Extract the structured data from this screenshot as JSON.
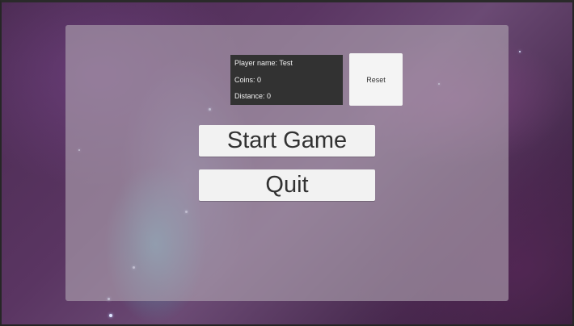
{
  "player_info": {
    "player_name": "Player name: Test",
    "coins": "Coins: 0",
    "distance": "Distance: 0"
  },
  "buttons": {
    "reset": "Reset",
    "start_game": "Start Game",
    "quit": "Quit"
  }
}
